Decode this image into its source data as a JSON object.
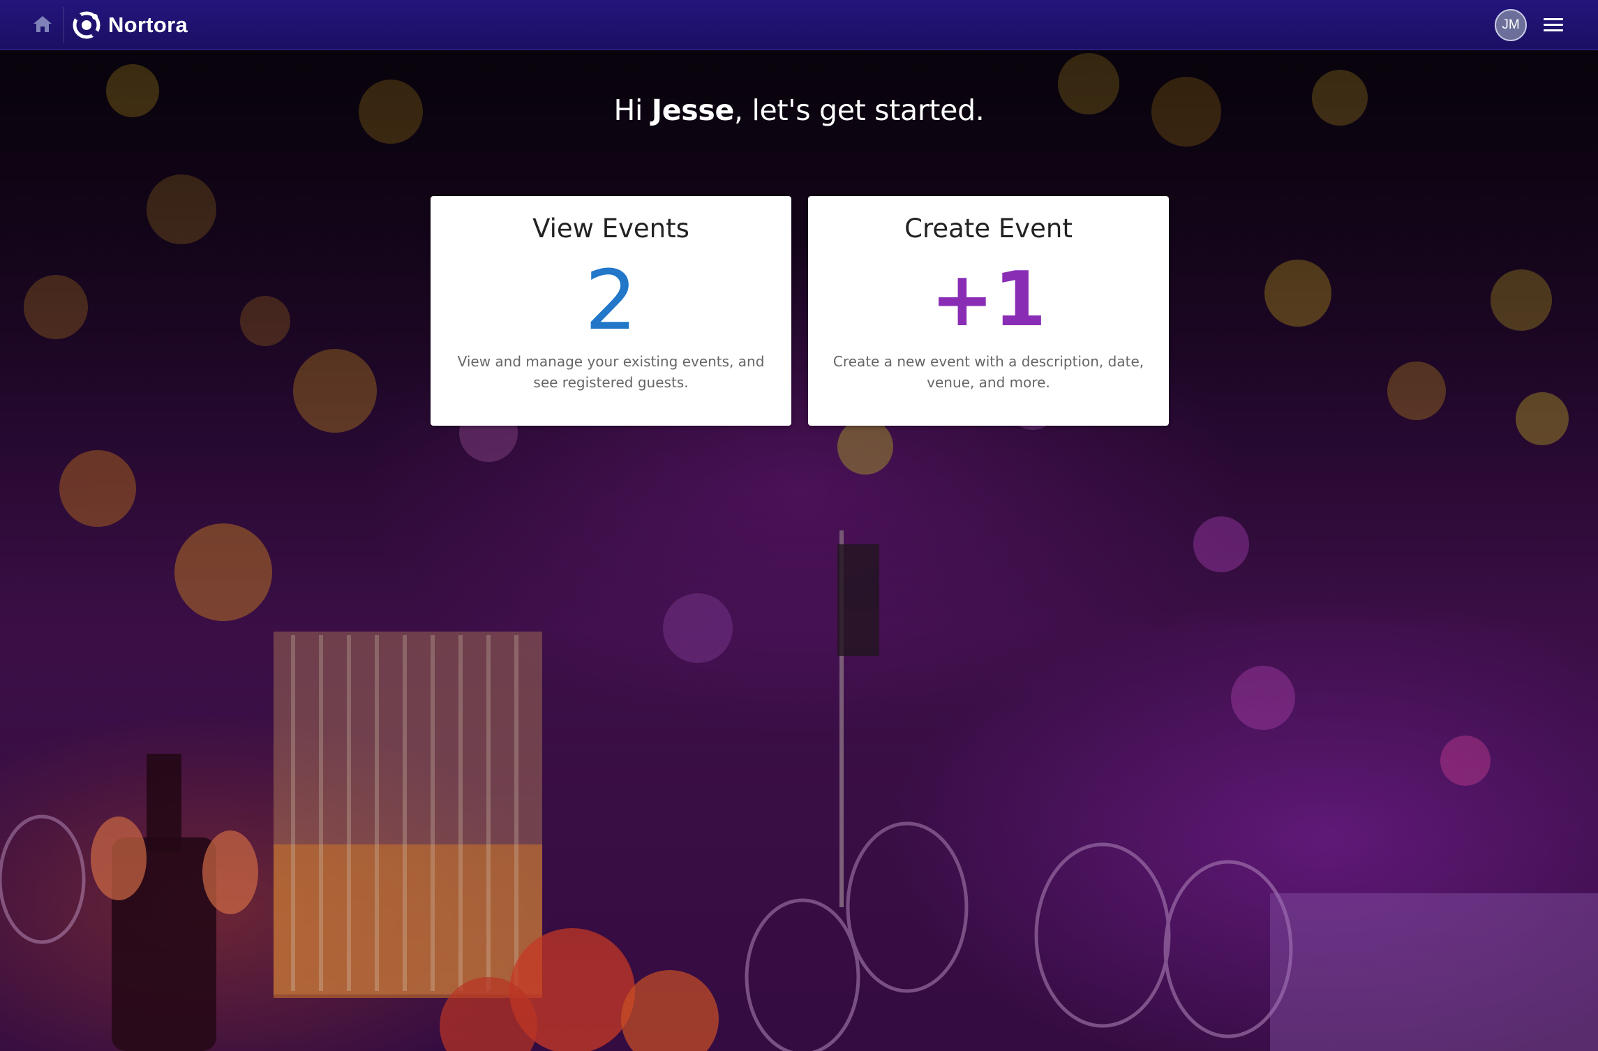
{
  "app": {
    "name": "Nortora"
  },
  "navbar": {
    "user_initials": "JM"
  },
  "greeting": {
    "prefix": "Hi ",
    "user_name": "Jesse",
    "suffix": ", let's get started."
  },
  "cards": {
    "view_events": {
      "title": "View Events",
      "stat": "2",
      "description": "View and manage your existing events, and see registered guests."
    },
    "create_event": {
      "title": "Create Event",
      "stat": "+1",
      "description": "Create a new event with a description, date, venue, and more."
    }
  },
  "colors": {
    "navbar": "#1f1370",
    "view_stat": "#2277c9",
    "create_stat": "#8a2db5"
  },
  "icons": {
    "home": "home-icon",
    "logo": "nortora-logo-icon",
    "menu": "hamburger-menu-icon"
  }
}
